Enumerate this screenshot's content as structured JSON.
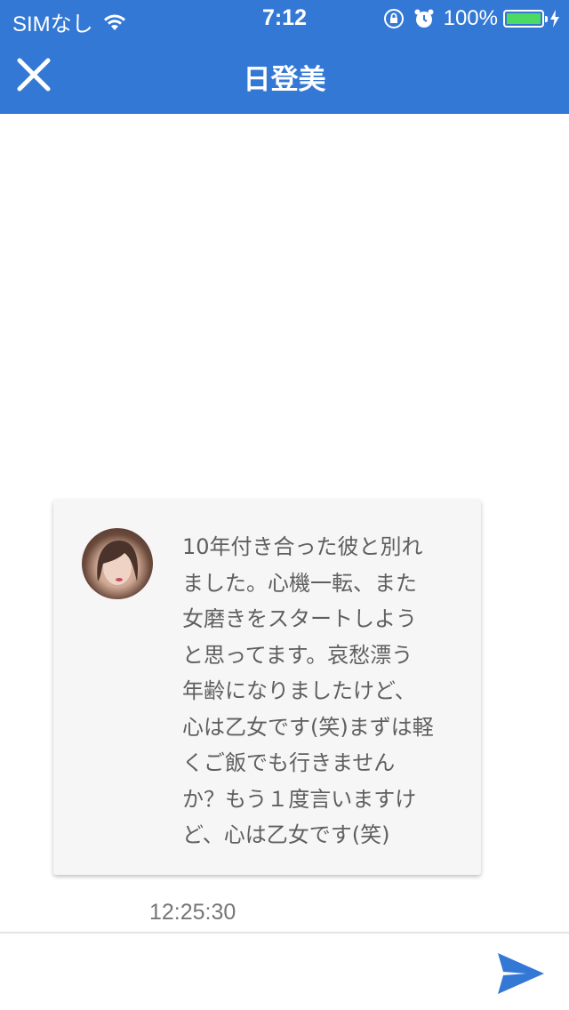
{
  "status_bar": {
    "carrier": "SIMなし",
    "time": "7:12",
    "battery_percent_label": "100%",
    "battery_level": 1.0,
    "icons": [
      "wifi-icon",
      "orientation-lock-icon",
      "alarm-icon",
      "battery-icon",
      "charging-bolt-icon"
    ]
  },
  "header": {
    "title": "日登美",
    "close_icon": "close-icon",
    "background_color": "#3478d5"
  },
  "message": {
    "avatar": "avatar",
    "text": "10年付き合った彼と別れ\nました。心機一転、また\n女磨きをスタートしよう\nと思ってます。哀愁漂う\n年齢になりましたけど、\n心は乙女です(笑)まずは軽\nくご飯でも行きません\nか？もう１度言いますけ\nど、心は乙女です(笑)",
    "timestamp": "12:25:30"
  },
  "composer": {
    "input_value": "",
    "send_icon": "send-icon",
    "accent_color": "#3478d5"
  }
}
